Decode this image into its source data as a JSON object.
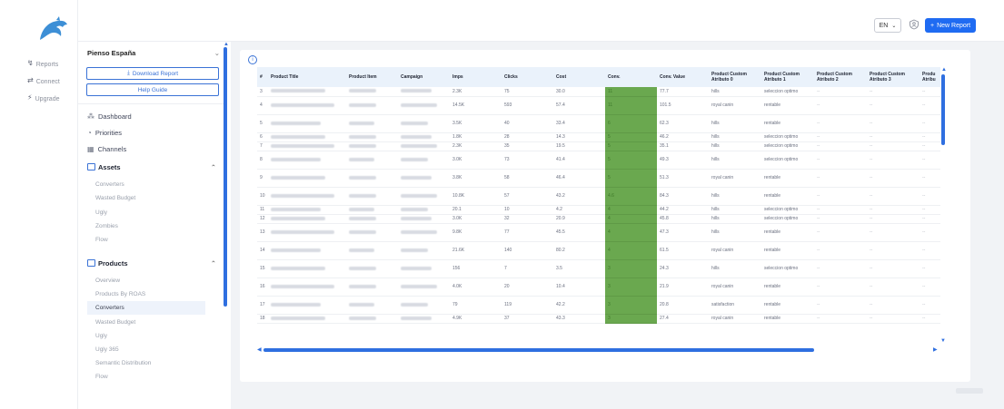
{
  "rail": {
    "items": [
      {
        "label": "Reports",
        "icon": "trend-icon"
      },
      {
        "label": "Connect",
        "icon": "plug-icon"
      },
      {
        "label": "Upgrade",
        "icon": "bolt-icon"
      }
    ]
  },
  "topbar": {
    "language": "EN",
    "new_report_label": "New Report"
  },
  "panel": {
    "account": "Pienso España",
    "download_label": "Download Report",
    "help_label": "Help Guide",
    "nav": [
      {
        "label": "Dashboard",
        "icon": "grid-icon"
      },
      {
        "label": "Priorities",
        "icon": "priority-icon"
      },
      {
        "label": "Channels",
        "icon": "channels-icon"
      }
    ],
    "assets": {
      "title": "Assets",
      "items": [
        "Converters",
        "Wasted Budget",
        "Ugly",
        "Zombies",
        "Flow"
      ]
    },
    "products": {
      "title": "Products",
      "items": [
        "Overview",
        "Products By ROAS",
        "Converters",
        "Wasted Budget",
        "Ugly",
        "Ugly 365",
        "Semantic Distribution",
        "Flow"
      ],
      "active": "Converters"
    }
  },
  "table": {
    "columns": [
      "#",
      "Product Title",
      "Product Item",
      "Campaign",
      "Imps",
      "Clicks",
      "Cost",
      "Conv.",
      "Conv. Value",
      "Product Custom Atributo 0",
      "Product Custom Atributo 1",
      "Product Custom Atributo 2",
      "Product Custom Atributo 3",
      "Produ Atribu"
    ],
    "rows": [
      {
        "n": "3",
        "imps": "2.3K",
        "clicks": "75",
        "cost": "30.0",
        "conv": "11",
        "value": "77.7",
        "a0": "hills",
        "a1": "seleccion optimo",
        "tall": false
      },
      {
        "n": "4",
        "imps": "14.5K",
        "clicks": "593",
        "cost": "57.4",
        "conv": "11",
        "value": "101.5",
        "a0": "royal canin",
        "a1": "rentable",
        "tall": true
      },
      {
        "n": "5",
        "imps": "3.5K",
        "clicks": "40",
        "cost": "33.4",
        "conv": "6",
        "value": "62.3",
        "a0": "hills",
        "a1": "rentable",
        "tall": true
      },
      {
        "n": "6",
        "imps": "1.8K",
        "clicks": "28",
        "cost": "14.3",
        "conv": "5",
        "value": "46.2",
        "a0": "hills",
        "a1": "seleccion optimo",
        "tall": false
      },
      {
        "n": "7",
        "imps": "2.3K",
        "clicks": "35",
        "cost": "19.5",
        "conv": "5",
        "value": "35.1",
        "a0": "hills",
        "a1": "seleccion optimo",
        "tall": false
      },
      {
        "n": "8",
        "imps": "3.0K",
        "clicks": "73",
        "cost": "41.4",
        "conv": "5",
        "value": "49.3",
        "a0": "hills",
        "a1": "seleccion optimo",
        "tall": true
      },
      {
        "n": "9",
        "imps": "3.8K",
        "clicks": "58",
        "cost": "46.4",
        "conv": "5",
        "value": "51.3",
        "a0": "royal canin",
        "a1": "rentable",
        "tall": true
      },
      {
        "n": "10",
        "imps": "10.8K",
        "clicks": "57",
        "cost": "43.2",
        "conv": "4.6",
        "value": "84.3",
        "a0": "hills",
        "a1": "rentable",
        "tall": true
      },
      {
        "n": "11",
        "imps": "20.1",
        "clicks": "10",
        "cost": "4.2",
        "conv": "4",
        "value": "44.2",
        "a0": "hills",
        "a1": "seleccion optimo",
        "tall": false
      },
      {
        "n": "12",
        "imps": "3.0K",
        "clicks": "32",
        "cost": "20.9",
        "conv": "4",
        "value": "45.8",
        "a0": "hills",
        "a1": "seleccion optimo",
        "tall": false
      },
      {
        "n": "13",
        "imps": "9.8K",
        "clicks": "77",
        "cost": "45.5",
        "conv": "4",
        "value": "47.3",
        "a0": "hills",
        "a1": "rentable",
        "tall": true
      },
      {
        "n": "14",
        "imps": "21.6K",
        "clicks": "140",
        "cost": "80.2",
        "conv": "4",
        "value": "61.5",
        "a0": "royal canin",
        "a1": "rentable",
        "tall": true
      },
      {
        "n": "15",
        "imps": "156",
        "clicks": "7",
        "cost": "3.5",
        "conv": "3",
        "value": "24.3",
        "a0": "hills",
        "a1": "seleccion optimo",
        "tall": true
      },
      {
        "n": "16",
        "imps": "4.0K",
        "clicks": "20",
        "cost": "10.4",
        "conv": "3",
        "value": "21.9",
        "a0": "royal canin",
        "a1": "rentable",
        "tall": true
      },
      {
        "n": "17",
        "imps": "79",
        "clicks": "119",
        "cost": "42.2",
        "conv": "3",
        "value": "20.8",
        "a0": "satisfaction",
        "a1": "rentable",
        "tall": true
      },
      {
        "n": "18",
        "imps": "4.9K",
        "clicks": "37",
        "cost": "43.3",
        "conv": "3",
        "value": "27.4",
        "a0": "royal canin",
        "a1": "rentable",
        "tall": false
      }
    ],
    "dash": "--"
  },
  "colors": {
    "accent": "#1f6bf2",
    "conv_cell": "#6aa84f",
    "header_bg": "#eaf2fb"
  }
}
